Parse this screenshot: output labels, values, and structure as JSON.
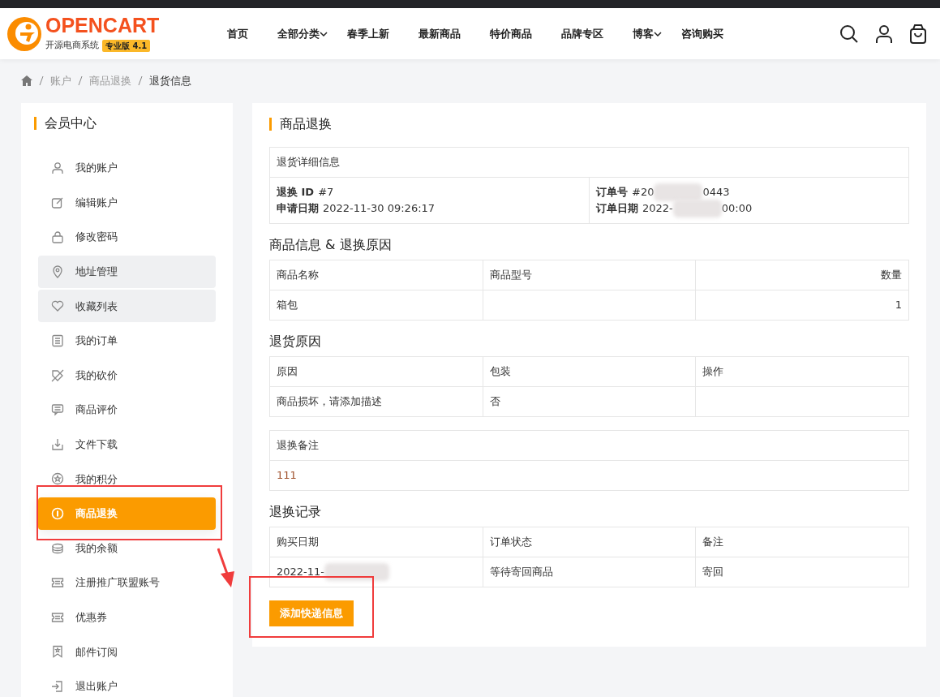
{
  "header": {
    "logo": {
      "brand": "OPENCART",
      "tagline": "开源电商系统",
      "edition": "专业版 4.1"
    },
    "nav": [
      {
        "label": "首页",
        "dropdown": false
      },
      {
        "label": "全部分类",
        "dropdown": true
      },
      {
        "label": "春季上新",
        "dropdown": false
      },
      {
        "label": "最新商品",
        "dropdown": false
      },
      {
        "label": "特价商品",
        "dropdown": false
      },
      {
        "label": "品牌专区",
        "dropdown": false
      },
      {
        "label": "博客",
        "dropdown": true
      },
      {
        "label": "咨询购买",
        "dropdown": false
      }
    ]
  },
  "breadcrumb": [
    "账户",
    "商品退换",
    "退货信息"
  ],
  "sidebar": {
    "title": "会员中心",
    "items": [
      {
        "label": "我的账户",
        "selected": false,
        "hovered": false
      },
      {
        "label": "编辑账户",
        "selected": false,
        "hovered": false
      },
      {
        "label": "修改密码",
        "selected": false,
        "hovered": false
      },
      {
        "label": "地址管理",
        "selected": false,
        "hovered": true
      },
      {
        "label": "收藏列表",
        "selected": false,
        "hovered": true
      },
      {
        "label": "我的订单",
        "selected": false,
        "hovered": false
      },
      {
        "label": "我的砍价",
        "selected": false,
        "hovered": false
      },
      {
        "label": "商品评价",
        "selected": false,
        "hovered": false
      },
      {
        "label": "文件下载",
        "selected": false,
        "hovered": false
      },
      {
        "label": "我的积分",
        "selected": false,
        "hovered": false
      },
      {
        "label": "商品退换",
        "selected": true,
        "hovered": false
      },
      {
        "label": "我的余额",
        "selected": false,
        "hovered": false
      },
      {
        "label": "注册推广联盟账号",
        "selected": false,
        "hovered": false
      },
      {
        "label": "优惠券",
        "selected": false,
        "hovered": false
      },
      {
        "label": "邮件订阅",
        "selected": false,
        "hovered": false
      },
      {
        "label": "退出账户",
        "selected": false,
        "hovered": false
      }
    ]
  },
  "main": {
    "title": "商品退换",
    "details": {
      "heading": "退货详细信息",
      "left": [
        {
          "label": "退换 ID",
          "value": "#7"
        },
        {
          "label": "申请日期",
          "value": "2022-11-30 09:26:17"
        }
      ],
      "right": [
        {
          "label": "订单号",
          "value": "#20",
          "value_end": "0443",
          "redacted": true
        },
        {
          "label": "订单日期",
          "value": "2022-",
          "value_end": "00:00",
          "redacted": true
        }
      ]
    },
    "sections": [
      {
        "title": "商品信息 & 退换原因",
        "columns": [
          {
            "label": "商品名称",
            "right_aligned": false
          },
          {
            "label": "商品型号",
            "right_aligned": false
          },
          {
            "label": "数量",
            "right_aligned": true
          }
        ],
        "rows": [
          [
            {
              "text": "箱包"
            },
            {},
            {
              "text": "1"
            }
          ]
        ]
      },
      {
        "title": "退货原因",
        "columns": [
          {
            "label": "原因",
            "right_aligned": false
          },
          {
            "label": "包装",
            "right_aligned": false
          },
          {
            "label": "操作",
            "right_aligned": false
          }
        ],
        "rows": [
          [
            {
              "text": "商品损坏，请添加描述"
            },
            {
              "text": "否"
            },
            {}
          ]
        ]
      },
      {
        "columns": [
          {
            "label": "退换备注",
            "right_aligned": false
          }
        ],
        "rows": [
          [
            {
              "text": "111"
            }
          ]
        ]
      },
      {
        "title": "退换记录",
        "columns": [
          {
            "label": "购买日期",
            "right_aligned": false
          },
          {
            "label": "订单状态",
            "right_aligned": false
          },
          {
            "label": "备注",
            "right_aligned": false
          }
        ],
        "rows": [
          [
            {
              "text": "2022-11-",
              "redacted": true
            },
            {
              "text": "等待寄回商品"
            },
            {
              "text": "寄回"
            }
          ]
        ]
      }
    ],
    "button": "添加快递信息"
  },
  "annotations": [
    {
      "kind": "box"
    },
    {
      "kind": "box"
    },
    {
      "kind": "arrow"
    }
  ]
}
